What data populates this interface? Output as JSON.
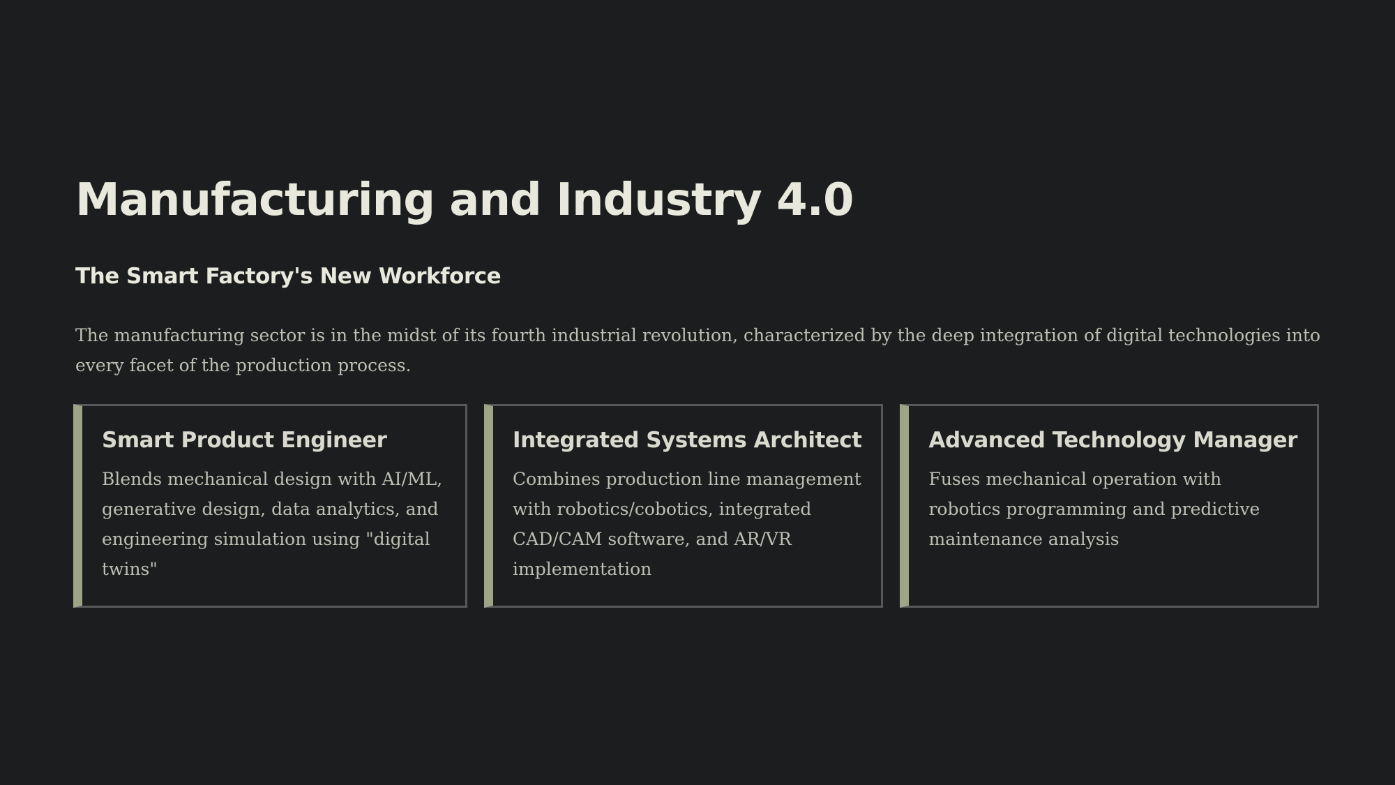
{
  "slide": {
    "title": "Manufacturing and Industry 4.0",
    "subtitle": "The Smart Factory's New Workforce",
    "intro": "The manufacturing sector is in the midst of its fourth industrial revolution, characterized by the deep integration of digital technologies into every facet of the production process."
  },
  "cards": [
    {
      "title": "Smart Product Engineer",
      "text": "Blends mechanical design with AI/ML, generative design, data analytics, and engineering simulation using \"digital twins\""
    },
    {
      "title": "Integrated Systems Architect",
      "text": "Combines production line management with robotics/cobotics, integrated CAD/CAM software, and AR/VR implementation"
    },
    {
      "title": "Advanced Technology Manager",
      "text": "Fuses mechanical operation with robotics programming and predictive maintenance analysis"
    }
  ],
  "colors": {
    "background": "#1c1d1f",
    "heading": "#e8e9dc",
    "body_text": "#bdbfb3",
    "card_border": "#56585a",
    "card_accent": "#9ea486"
  }
}
